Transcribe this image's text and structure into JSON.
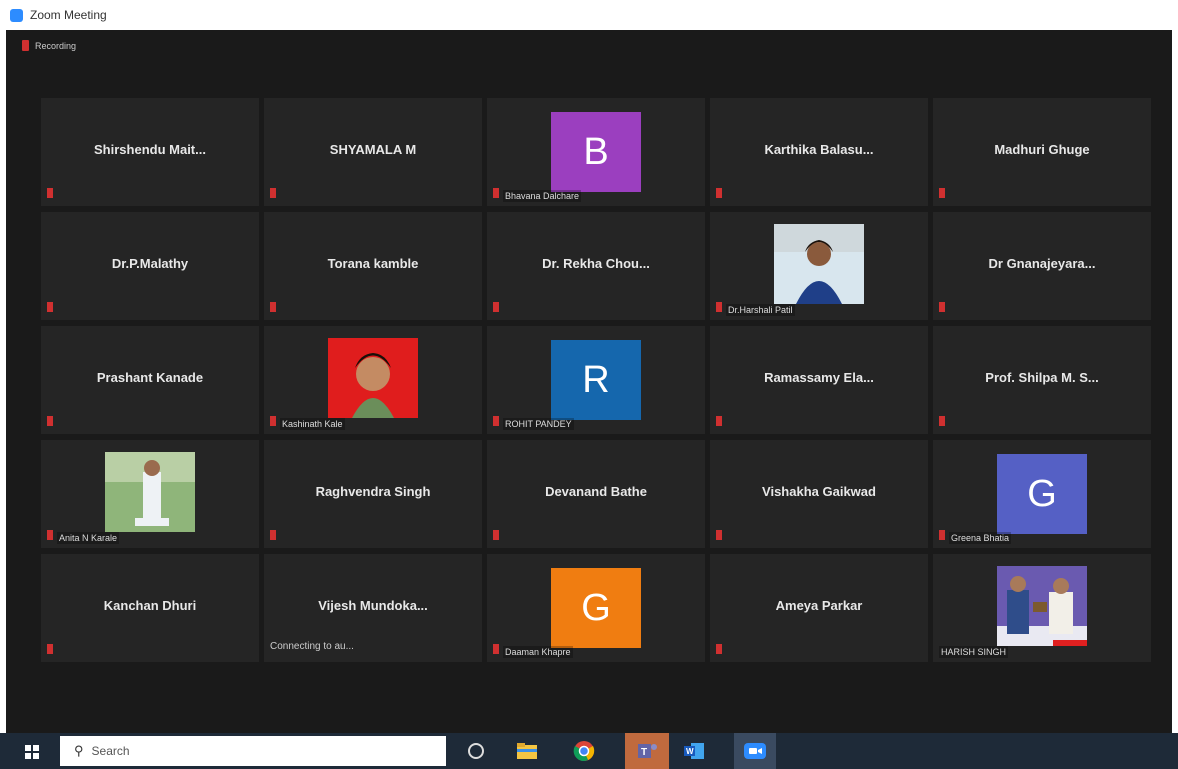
{
  "window": {
    "title": "Zoom Meeting"
  },
  "recording": {
    "label": "Recording"
  },
  "participants": [
    {
      "name": "Shirshendu Mait...",
      "type": "name"
    },
    {
      "name": "SHYAMALA M",
      "type": "name"
    },
    {
      "name": "Bhavana Dalchare",
      "type": "avatar",
      "initial": "B",
      "color": "#9b3fbf"
    },
    {
      "name": "Karthika Balasu...",
      "type": "name"
    },
    {
      "name": "Madhuri Ghuge",
      "type": "name"
    },
    {
      "name": "Dr.P.Malathy",
      "type": "name"
    },
    {
      "name": "Torana kamble",
      "type": "name"
    },
    {
      "name": "Dr. Rekha Chou...",
      "type": "name"
    },
    {
      "name": "Dr.Harshali Patil",
      "type": "photo"
    },
    {
      "name": "Dr Gnanajeyara...",
      "type": "name"
    },
    {
      "name": "Prashant Kanade",
      "type": "name"
    },
    {
      "name": "Kashinath Kale",
      "type": "photo"
    },
    {
      "name": "ROHIT PANDEY",
      "type": "avatar",
      "initial": "R",
      "color": "#1567ad"
    },
    {
      "name": "Ramassamy Ela...",
      "type": "name"
    },
    {
      "name": "Prof. Shilpa M. S...",
      "type": "name"
    },
    {
      "name": "Anita N Karale",
      "type": "photo"
    },
    {
      "name": "Raghvendra Singh",
      "type": "name"
    },
    {
      "name": "Devanand Bathe",
      "type": "name"
    },
    {
      "name": "Vishakha Gaikwad",
      "type": "name"
    },
    {
      "name": "Greena Bhatia",
      "type": "avatar",
      "initial": "G",
      "color": "#5560c5"
    },
    {
      "name": "Kanchan Dhuri",
      "type": "name"
    },
    {
      "name": "Vijesh Mundoka...",
      "type": "name",
      "status": "Connecting to au..."
    },
    {
      "name": "Daaman Khapre",
      "type": "avatar",
      "initial": "G",
      "color": "#f07d11"
    },
    {
      "name": "Ameya Parkar",
      "type": "name"
    },
    {
      "name": "HARISH SINGH",
      "type": "photo",
      "no_mic": true
    }
  ],
  "taskbar": {
    "search_placeholder": "Search",
    "search_icon": "search-icon",
    "start_icon": "windows-start-icon"
  }
}
